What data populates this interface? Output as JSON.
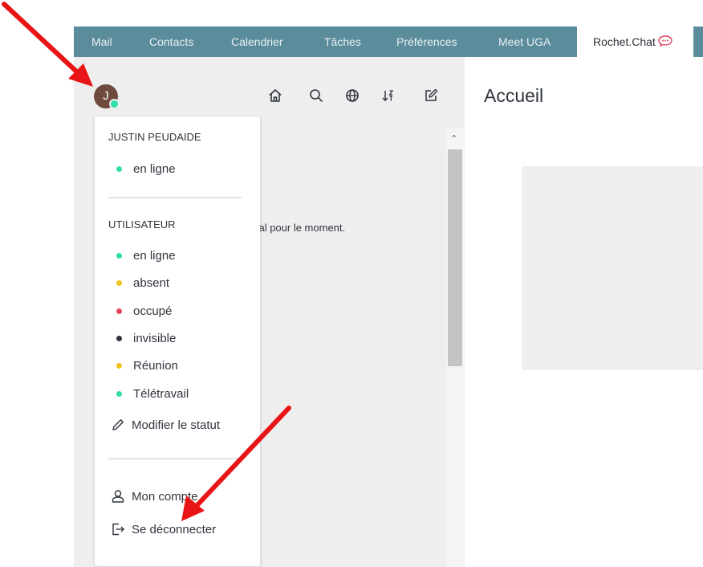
{
  "topnav": {
    "tabs": [
      {
        "label": "Mail"
      },
      {
        "label": "Contacts"
      },
      {
        "label": "Calendrier"
      },
      {
        "label": "Tâches"
      },
      {
        "label": "Préférences"
      },
      {
        "label": "Meet UGA"
      },
      {
        "label": "Rochet.Chat",
        "active": true
      }
    ],
    "bar_color": "#5a8c9c"
  },
  "avatar": {
    "initial": "J",
    "status_color": "#2de0a5",
    "bg_color": "#6d4a3d"
  },
  "toolbar": {
    "icons": [
      "home-icon",
      "search-icon",
      "globe-icon",
      "sort-icon",
      "edit-icon"
    ]
  },
  "sidebar": {
    "empty_text": "anal pour le moment."
  },
  "main": {
    "title": "Accueil"
  },
  "user_menu": {
    "user_name": "JUSTIN PEUDAIDE",
    "current_status": {
      "label": "en ligne",
      "color": "#2de0a5"
    },
    "section_title": "UTILISATEUR",
    "statuses": [
      {
        "label": "en ligne",
        "color": "#2de0a5"
      },
      {
        "label": "absent",
        "color": "#f3c11b"
      },
      {
        "label": "occupé",
        "color": "#e5455f"
      },
      {
        "label": "invisible",
        "color": "#2f343d"
      },
      {
        "label": "Réunion",
        "color": "#f3c11b"
      },
      {
        "label": "Télétravail",
        "color": "#2de0a5"
      }
    ],
    "edit_status_label": "Modifier le statut",
    "account_label": "Mon compte",
    "logout_label": "Se déconnecter"
  },
  "annotation_color": "#e81416"
}
